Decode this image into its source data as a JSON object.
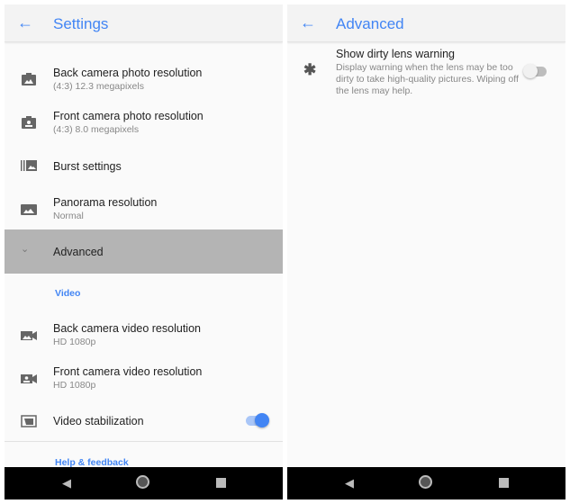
{
  "settings": {
    "title": "Settings",
    "items": [
      {
        "label": "Back camera photo resolution",
        "sub": "(4:3) 12.3 megapixels",
        "icon": "camera-rear-icon"
      },
      {
        "label": "Front camera photo resolution",
        "sub": "(4:3) 8.0 megapixels",
        "icon": "camera-front-icon"
      },
      {
        "label": "Burst settings",
        "icon": "burst-icon"
      },
      {
        "label": "Panorama resolution",
        "sub": "Normal",
        "icon": "panorama-icon"
      },
      {
        "label": "Advanced",
        "icon": "chevron-down-icon"
      }
    ],
    "video_category": "Video",
    "video_items": [
      {
        "label": "Back camera video resolution",
        "sub": "HD 1080p",
        "icon": "videocam-rear-icon"
      },
      {
        "label": "Front camera video resolution",
        "sub": "HD 1080p",
        "icon": "videocam-front-icon"
      },
      {
        "label": "Video stabilization",
        "icon": "stabilization-icon",
        "toggle": true
      }
    ],
    "help_category": "Help & feedback"
  },
  "advanced": {
    "title": "Advanced",
    "item": {
      "label": "Show dirty lens warning",
      "sub": "Display warning when the lens may be too dirty to take high-quality pictures. Wiping off the lens may help.",
      "toggle": false,
      "icon": "dirty-lens-icon"
    }
  },
  "colors": {
    "accent": "#4285f4",
    "highlight": "#b4b4b4"
  }
}
